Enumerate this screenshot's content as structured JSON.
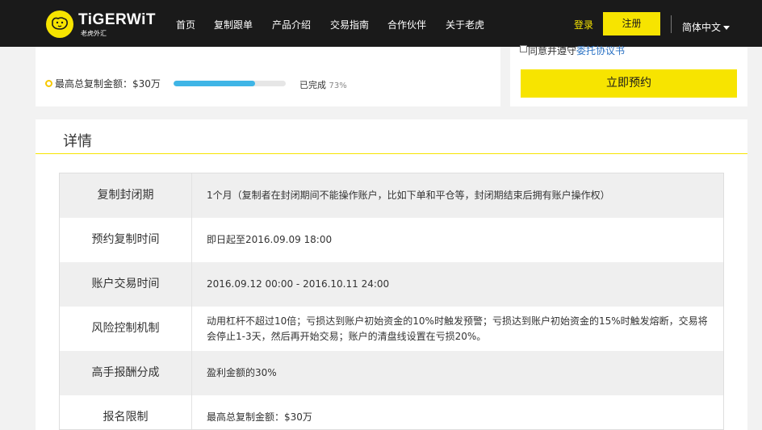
{
  "header": {
    "logo_text": "TiGERWiT",
    "logo_sub": "老虎外汇",
    "nav": [
      "首页",
      "复制跟单",
      "产品介绍",
      "交易指南",
      "合作伙伴",
      "关于老虎"
    ],
    "login": "登录",
    "register": "注册",
    "language": "简体中文"
  },
  "summary": {
    "max_copy_label": "最高总复制金额：$30万",
    "progress": 0.73,
    "done_label": "已完成",
    "done_pct": "73%"
  },
  "booking": {
    "agree_text": "同意并遵守",
    "agree_link": "委托协议书",
    "reserve_button": "立即预约"
  },
  "details": {
    "title": "详情",
    "rows": [
      {
        "label": "复制封闭期",
        "value": "1个月（复制者在封闭期间不能操作账户，比如下单和平仓等，封闭期结束后拥有账户操作权）"
      },
      {
        "label": "预约复制时间",
        "value": "即日起至2016.09.09 18:00"
      },
      {
        "label": "账户交易时间",
        "value": "2016.09.12 00:00 - 2016.10.11 24:00"
      },
      {
        "label": "风险控制机制",
        "value": "动用杠杆不超过10倍；亏损达到账户初始资金的10%时触发预警；亏损达到账户初始资金的15%时触发熔断，交易将会停止1-3天，然后再开始交易；账户的清盘线设置在亏损20%。"
      },
      {
        "label": "高手报酬分成",
        "value": "盈利金额的30%"
      },
      {
        "label": "报名限制",
        "value": "最高总复制金额：$30万"
      }
    ]
  },
  "colors": {
    "brand_yellow": "#f7e400",
    "topbar": "#1a1a1a",
    "progress_blue": "#3fb5e6",
    "link_blue": "#2a72c4"
  }
}
